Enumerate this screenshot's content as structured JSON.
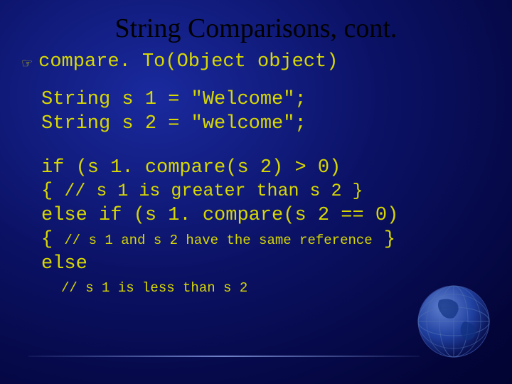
{
  "title": "String Comparisons, cont.",
  "bullet": {
    "method": "compare. To(Object object)"
  },
  "code": {
    "decl1": "String s 1 = \"Welcome\";",
    "decl2": "String s 2 = \"welcome\";",
    "if_line": "if (s 1. compare(s 2) > 0)",
    "if_open": "{  ",
    "if_comment": "// s 1 is greater than s 2 }",
    "elseif_line": "else if (s 1. compare(s 2 == 0)",
    "elseif_open": "{ ",
    "elseif_comment": "// s 1 and s 2 have the same reference",
    "elseif_close": " }",
    "else_line": "else",
    "else_comment": "// s 1 is less than s 2"
  }
}
